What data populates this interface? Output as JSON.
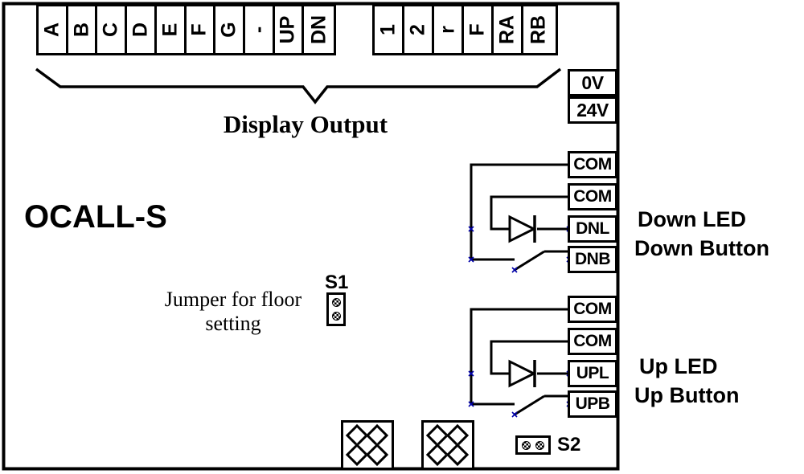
{
  "board": {
    "title": "OCALL-S",
    "display_output_label": "Display Output",
    "jumper_label_line1": "Jumper for floor",
    "jumper_label_line2": "setting"
  },
  "display_terminal_block": {
    "name": "display-output-terminals",
    "pins": [
      "A",
      "B",
      "C",
      "D",
      "E",
      "F",
      "G",
      "-",
      "UP",
      "DN"
    ]
  },
  "secondary_terminal_block": {
    "name": "secondary-terminals",
    "pins": [
      "1",
      "2",
      "r",
      "F",
      "RA",
      "RB"
    ]
  },
  "power_terminals": {
    "pins": [
      "0V",
      "24V"
    ]
  },
  "down_group": {
    "pins": [
      "COM",
      "COM",
      "DNL",
      "DNB"
    ],
    "label_line1": "Down LED",
    "label_line2": "Down Button"
  },
  "up_group": {
    "pins": [
      "COM",
      "COM",
      "UPL",
      "UPB"
    ],
    "label_line1": "Up LED",
    "label_line2": "Up Button"
  },
  "connectors": {
    "s1_label": "S1",
    "s2_label": "S2"
  },
  "colors": {
    "stroke": "#000000",
    "background": "#ffffff",
    "wire": "#000000"
  }
}
